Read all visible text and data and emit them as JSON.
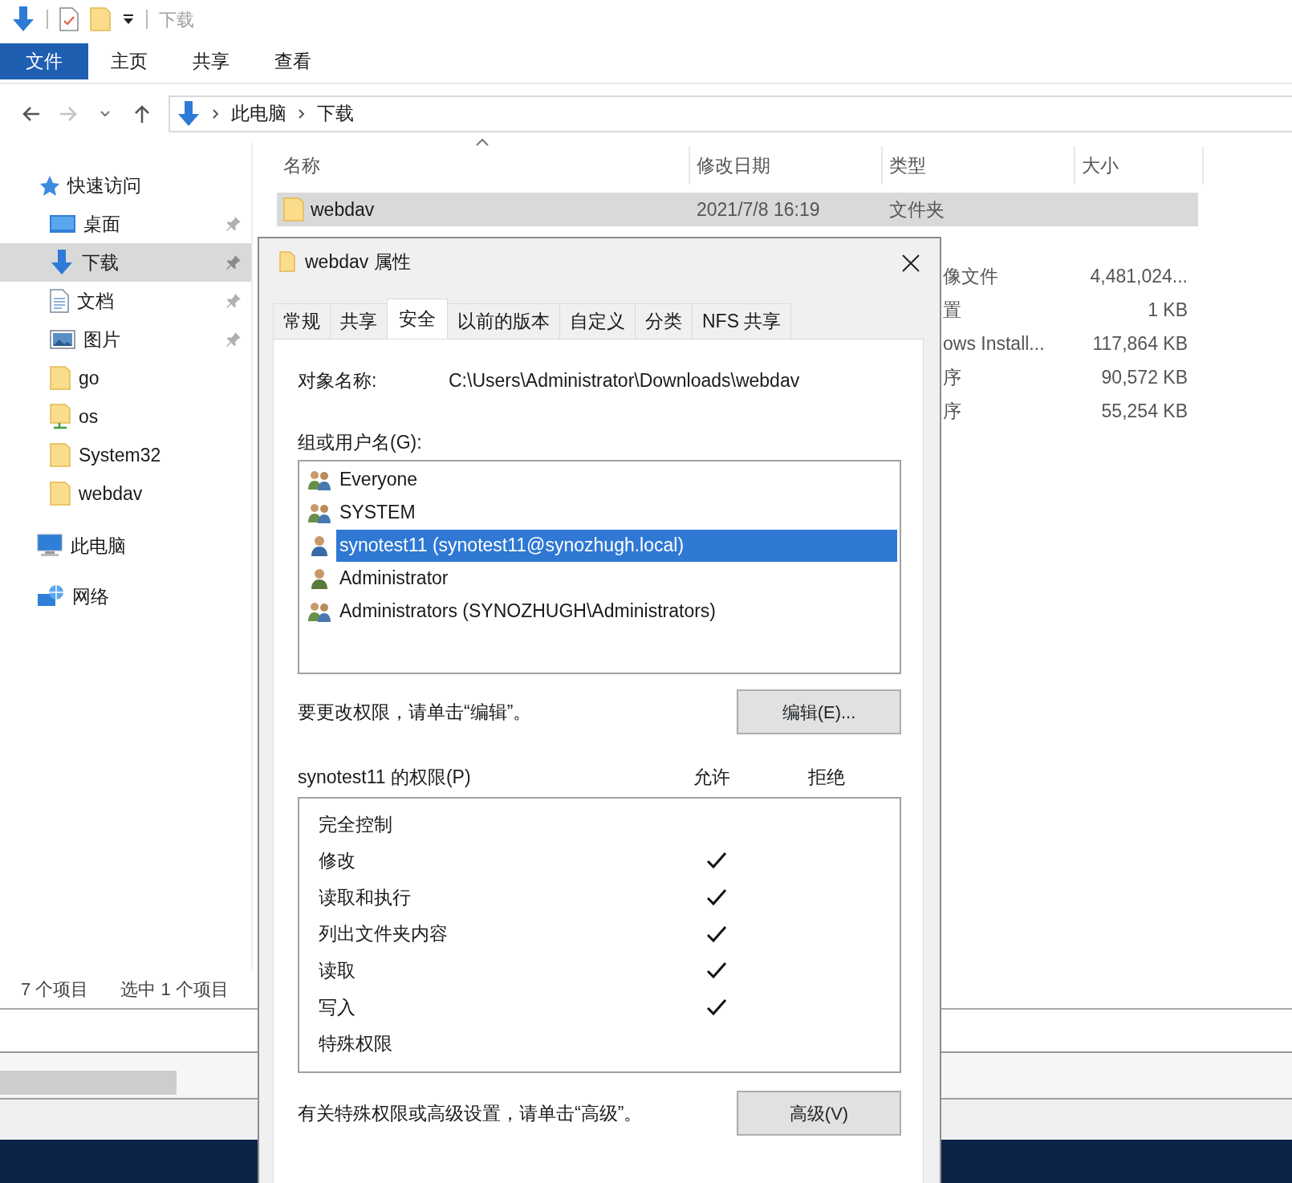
{
  "quick_access_toolbar": {
    "title": "下载"
  },
  "ribbon_tabs": [
    {
      "label": "文件",
      "kind": "file"
    },
    {
      "label": "主页",
      "kind": "tab"
    },
    {
      "label": "共享",
      "kind": "tab"
    },
    {
      "label": "查看",
      "kind": "tab"
    }
  ],
  "address_bar": {
    "path": [
      "此电脑",
      "下载"
    ]
  },
  "nav_pane": {
    "items": [
      {
        "label": "快速访问",
        "kind": "star",
        "pinned": false,
        "selected": false,
        "children": [
          {
            "label": "桌面",
            "kind": "desktop",
            "pinned": true,
            "selected": false
          },
          {
            "label": "下载",
            "kind": "download",
            "pinned": true,
            "selected": true
          },
          {
            "label": "文档",
            "kind": "document",
            "pinned": true,
            "selected": false
          },
          {
            "label": "图片",
            "kind": "picture",
            "pinned": true,
            "selected": false
          },
          {
            "label": "go",
            "kind": "folder",
            "pinned": false,
            "selected": false
          },
          {
            "label": "os",
            "kind": "netfolder",
            "pinned": false,
            "selected": false
          },
          {
            "label": "System32",
            "kind": "folder",
            "pinned": false,
            "selected": false
          },
          {
            "label": "webdav",
            "kind": "folder",
            "pinned": false,
            "selected": false
          }
        ]
      },
      {
        "label": "此电脑",
        "kind": "pc",
        "pinned": false,
        "selected": false
      },
      {
        "label": "网络",
        "kind": "network",
        "pinned": false,
        "selected": false
      }
    ]
  },
  "file_list": {
    "columns": [
      {
        "label": "名称",
        "sorted": true
      },
      {
        "label": "修改日期",
        "sorted": false
      },
      {
        "label": "类型",
        "sorted": false
      },
      {
        "label": "大小",
        "sorted": false
      }
    ],
    "rows": [
      {
        "name": "webdav",
        "date": "2021/7/8 16:19",
        "type": "文件夹",
        "selected": true
      },
      {
        "type": "像文件",
        "size": "4,481,024...",
        "selected": false
      },
      {
        "type": "置",
        "size": "1 KB",
        "selected": false
      },
      {
        "type": "ows Install...",
        "size": "117,864 KB",
        "selected": false
      },
      {
        "type": "序",
        "size": "90,572 KB",
        "selected": false
      },
      {
        "type": "序",
        "size": "55,254 KB",
        "selected": false
      }
    ]
  },
  "status_bar": {
    "item_count": "7 个项目",
    "selection": "选中 1 个项目"
  },
  "dialog": {
    "title": "webdav 属性",
    "tabs": [
      {
        "label": "常规",
        "selected": false
      },
      {
        "label": "共享",
        "selected": false
      },
      {
        "label": "安全",
        "selected": true
      },
      {
        "label": "以前的版本",
        "selected": false
      },
      {
        "label": "自定义",
        "selected": false
      },
      {
        "label": "分类",
        "selected": false
      },
      {
        "label": "NFS 共享",
        "selected": false
      }
    ],
    "object_name_label": "对象名称:",
    "object_name": "C:\\Users\\Administrator\\Downloads\\webdav",
    "users_label": "组或用户名(G):",
    "users": [
      {
        "name": "Everyone",
        "kind": "group",
        "selected": false
      },
      {
        "name": "SYSTEM",
        "kind": "group",
        "selected": false
      },
      {
        "name": "synotest11 (synotest11@synozhugh.local)",
        "kind": "user",
        "selected": true
      },
      {
        "name": "Administrator",
        "kind": "user",
        "selected": false
      },
      {
        "name": "Administrators (SYNOZHUGH\\Administrators)",
        "kind": "group",
        "selected": false
      }
    ],
    "edit_hint": "要更改权限，请单击“编辑”。",
    "edit_button": "编辑(E)...",
    "permissions_label": "synotest11 的权限(P)",
    "allow_header": "允许",
    "deny_header": "拒绝",
    "permissions": [
      {
        "name": "完全控制",
        "allow": false
      },
      {
        "name": "修改",
        "allow": true
      },
      {
        "name": "读取和执行",
        "allow": true
      },
      {
        "name": "列出文件夹内容",
        "allow": true
      },
      {
        "name": "读取",
        "allow": true
      },
      {
        "name": "写入",
        "allow": true
      },
      {
        "name": "特殊权限",
        "allow": false
      }
    ],
    "advanced_hint": "有关特殊权限或高级设置，请单击“高级”。",
    "advanced_button": "高级(V)"
  }
}
